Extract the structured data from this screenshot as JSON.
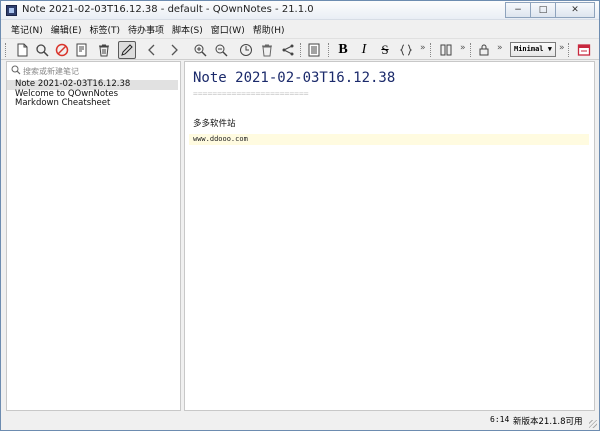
{
  "window": {
    "title": "Note 2021-02-03T16.12.38 - default - QOwnNotes - 21.1.0",
    "minimize": "−",
    "maximize": "□",
    "close": "✕"
  },
  "menu": [
    "笔记(N)",
    "编辑(E)",
    "标签(T)",
    "待办事项",
    "脚本(S)",
    "窗口(W)",
    "帮助(H)"
  ],
  "toolbar": {
    "more": "»",
    "style_select": "Minimal",
    "style_arrow": "▼"
  },
  "search": {
    "placeholder": "搜索或新建笔记"
  },
  "notes": [
    "Note 2021-02-03T16.12.38",
    "Welcome to QOwnNotes",
    "Markdown Cheatsheet"
  ],
  "editor": {
    "title": "Note 2021-02-03T16.12.38",
    "underline": "========================",
    "paragraph": "多多软件站",
    "url": "www.ddooo.com"
  },
  "status": {
    "cursor": "6:14",
    "update": "新版本21.1.8可用"
  },
  "colors": {
    "title_blue": "#1b2a6b",
    "highlight": "#fffbe0",
    "stop_red": "#d9342b",
    "close_red": "#c8283e"
  }
}
